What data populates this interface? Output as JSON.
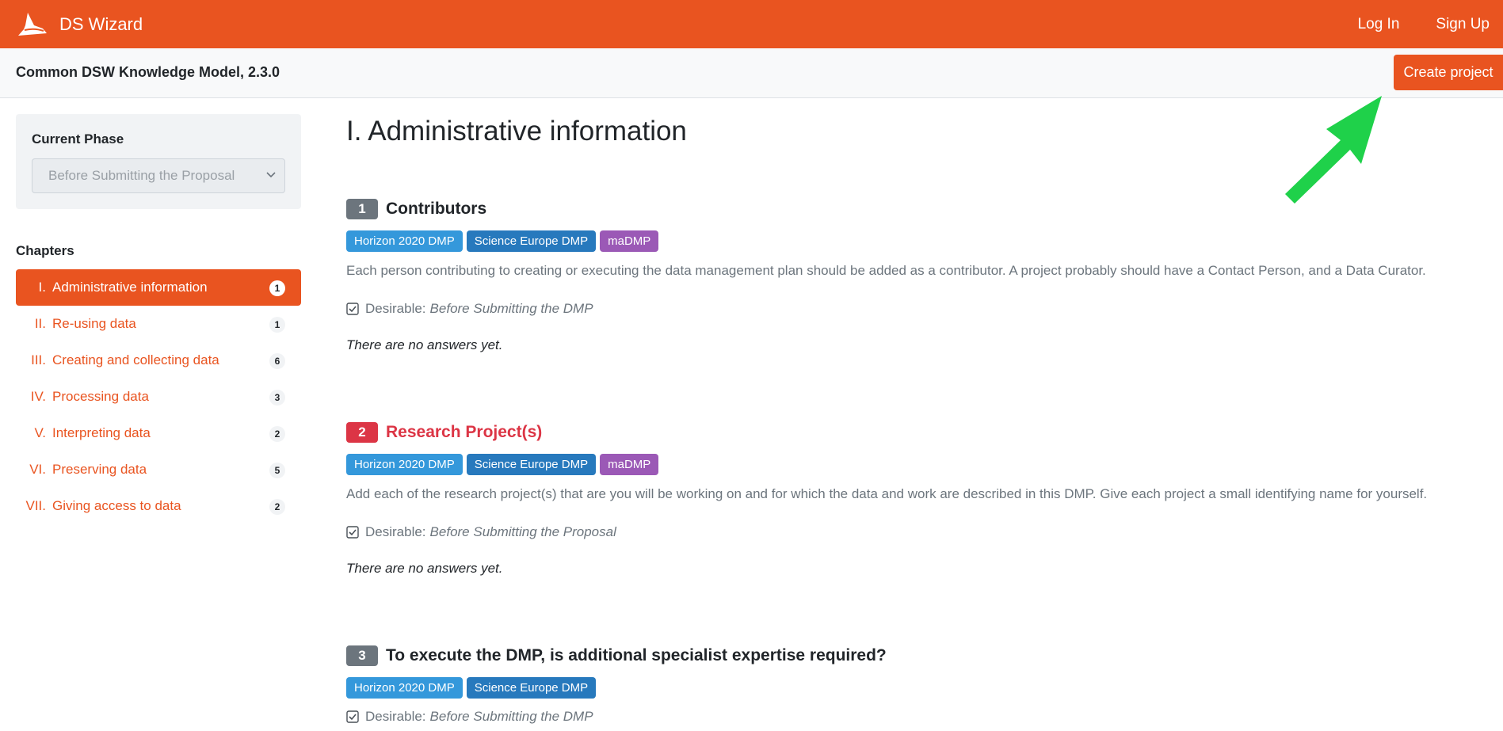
{
  "navbar": {
    "brand": "DS Wizard",
    "login": "Log In",
    "signup": "Sign Up"
  },
  "header": {
    "km_title": "Common DSW Knowledge Model, 2.3.0",
    "create_project": "Create project"
  },
  "sidebar": {
    "phase_label": "Current Phase",
    "phase_value": "Before Submitting the Proposal",
    "chapters_label": "Chapters",
    "chapters": [
      {
        "num": "I.",
        "label": "Administrative information",
        "count": "1"
      },
      {
        "num": "II.",
        "label": "Re-using data",
        "count": "1"
      },
      {
        "num": "III.",
        "label": "Creating and collecting data",
        "count": "6"
      },
      {
        "num": "IV.",
        "label": "Processing data",
        "count": "3"
      },
      {
        "num": "V.",
        "label": "Interpreting data",
        "count": "2"
      },
      {
        "num": "VI.",
        "label": "Preserving data",
        "count": "5"
      },
      {
        "num": "VII.",
        "label": "Giving access to data",
        "count": "2"
      }
    ]
  },
  "main": {
    "chapter_title": "I. Administrative information",
    "questions": [
      {
        "number": "1",
        "title": "Contributors",
        "tags": [
          "Horizon 2020 DMP",
          "Science Europe DMP",
          "maDMP"
        ],
        "description": "Each person contributing to creating or executing the data management plan should be added as a contributor. A project probably should have a Contact Person, and a Data Curator.",
        "desirable_label": "Desirable:",
        "desirable_phase": "Before Submitting the DMP",
        "no_answers": "There are no answers yet."
      },
      {
        "number": "2",
        "title": "Research Project(s)",
        "tags": [
          "Horizon 2020 DMP",
          "Science Europe DMP",
          "maDMP"
        ],
        "description": "Add each of the research project(s) that are you will be working on and for which the data and work are described in this DMP. Give each project a small identifying name for yourself.",
        "desirable_label": "Desirable:",
        "desirable_phase": "Before Submitting the Proposal",
        "no_answers": "There are no answers yet."
      },
      {
        "number": "3",
        "title": "To execute the DMP, is additional specialist expertise required?",
        "tags": [
          "Horizon 2020 DMP",
          "Science Europe DMP"
        ],
        "desirable_label": "Desirable:",
        "desirable_phase": "Before Submitting the DMP"
      }
    ]
  },
  "colors": {
    "brand": "#e95420",
    "tag_horizon": "#3498db",
    "tag_science_europe": "#2779bd",
    "tag_madmp": "#9b59b6",
    "question_error": "#dc3545",
    "arrow": "#1fd14a"
  },
  "icons": [
    "wizard-hat-icon",
    "chevron-down-icon",
    "checkbox-checked-icon",
    "annotation-arrow"
  ]
}
